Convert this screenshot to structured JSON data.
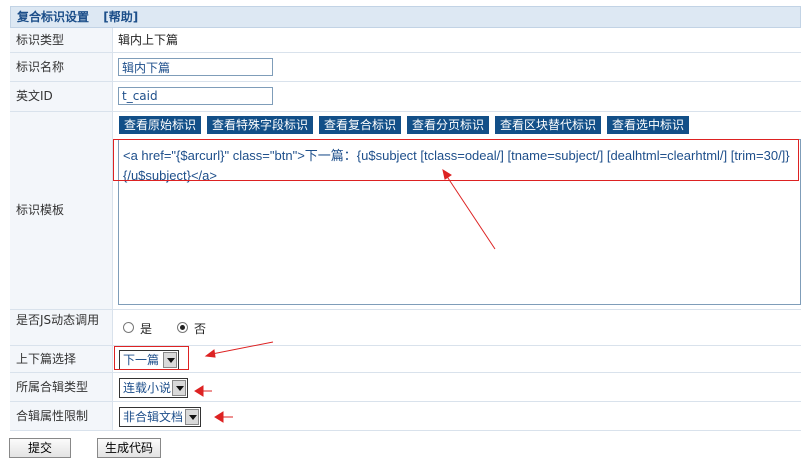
{
  "header": {
    "title": "复合标识设置",
    "help": "[帮助]"
  },
  "fields": {
    "type_label": "标识类型",
    "type_value": "辑内上下篇",
    "name_label": "标识名称",
    "name_value": "辑内下篇",
    "eng_label": "英文ID",
    "eng_value": "t_caid",
    "template_label": "标识模板",
    "template_value": "<a href=\"{$arcurl}\" class=\"btn\">下一篇：{u$subject [tclass=odeal/] [tname=subject/] [dealhtml=clearhtml/] [trim=30/]}{/u$subject}</a>",
    "js_label": "是否JS动态调用",
    "js_yes": "是",
    "js_no": "否",
    "prevnext_label": "上下篇选择",
    "prevnext_value": "下一篇",
    "album_label": "所属合辑类型",
    "album_value": "连载小说",
    "albumattr_label": "合辑属性限制",
    "albumattr_value": "非合辑文档"
  },
  "tag_buttons": [
    "查看原始标识",
    "查看特殊字段标识",
    "查看复合标识",
    "查看分页标识",
    "查看区块替代标识",
    "查看选中标识"
  ],
  "actions": {
    "submit": "提交",
    "generate": "生成代码"
  },
  "colors": {
    "header_bg": "#dde8f3",
    "accent": "#124f88",
    "annotation": "#dd2222"
  }
}
